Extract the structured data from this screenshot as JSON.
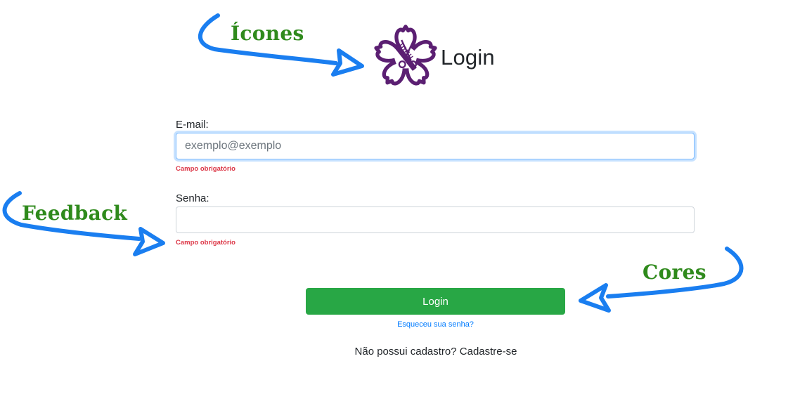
{
  "header": {
    "title": "Login",
    "logo_icon": "sakura-comb-scissors-icon",
    "logo_color": "#5b1f72"
  },
  "form": {
    "email": {
      "label": "E-mail:",
      "value": "",
      "placeholder": "exemplo@exemplo",
      "error": "Campo obrigatório"
    },
    "password": {
      "label": "Senha:",
      "value": "",
      "placeholder": "",
      "error": "Campo obrigatório"
    },
    "submit_label": "Login",
    "forgot_label": "Esqueceu sua senha?",
    "signup_prompt": "Não possui cadastro?",
    "signup_link": "Cadastre-se"
  },
  "annotations": {
    "icons": "Ícones",
    "feedback": "Feedback",
    "colors": "Cores",
    "text_color": "#2f8a1c",
    "arrow_color": "#1a7ef0"
  },
  "colors": {
    "primary_button": "#28a745",
    "error": "#dc3545",
    "link": "#007bff"
  }
}
